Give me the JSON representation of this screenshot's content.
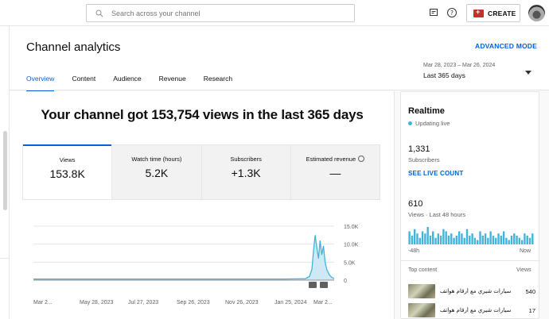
{
  "topbar": {
    "search_placeholder": "Search across your channel",
    "create_label": "CREATE"
  },
  "header": {
    "title": "Channel analytics",
    "advanced_mode": "ADVANCED MODE",
    "tabs": [
      {
        "label": "Overview",
        "active": true
      },
      {
        "label": "Content"
      },
      {
        "label": "Audience"
      },
      {
        "label": "Revenue"
      },
      {
        "label": "Research"
      }
    ],
    "date_range": {
      "dates": "Mar 28, 2023 – Mar 26, 2024",
      "label": "Last 365 days"
    }
  },
  "main": {
    "headline": "Your channel got 153,754 views in the last 365 days",
    "metrics": [
      {
        "label": "Views",
        "value": "153.8K",
        "active": true
      },
      {
        "label": "Watch time (hours)",
        "value": "5.2K"
      },
      {
        "label": "Subscribers",
        "value": "+1.3K"
      },
      {
        "label": "Estimated revenue",
        "value": "—"
      }
    ]
  },
  "chart_data": {
    "type": "area",
    "title": "",
    "xlabel": "",
    "ylabel": "",
    "ylim": [
      0,
      15000
    ],
    "y_ticks": [
      "15.0K",
      "10.0K",
      "5.0K",
      "0"
    ],
    "x_ticks": [
      "Mar 2...",
      "May 28, 2023",
      "Jul 27, 2023",
      "Sep 26, 2023",
      "Nov 26, 2023",
      "Jan 25, 2024",
      "Mar 2..."
    ],
    "series": [
      {
        "values": [
          {
            "x": "2023-03-28",
            "y": 300
          },
          {
            "x": "2023-05-28",
            "y": 300
          },
          {
            "x": "2023-07-27",
            "y": 300
          },
          {
            "x": "2023-09-26",
            "y": 300
          },
          {
            "x": "2023-11-26",
            "y": 300
          },
          {
            "x": "2024-01-25",
            "y": 300
          },
          {
            "x": "2024-02-20",
            "y": 400
          },
          {
            "x": "2024-02-25",
            "y": 1000
          },
          {
            "x": "2024-02-28",
            "y": 3000
          },
          {
            "x": "2024-03-01",
            "y": 8000
          },
          {
            "x": "2024-03-03",
            "y": 12500
          },
          {
            "x": "2024-03-05",
            "y": 9000
          },
          {
            "x": "2024-03-07",
            "y": 6000
          },
          {
            "x": "2024-03-09",
            "y": 11000
          },
          {
            "x": "2024-03-11",
            "y": 7000
          },
          {
            "x": "2024-03-13",
            "y": 9500
          },
          {
            "x": "2024-03-15",
            "y": 5000
          },
          {
            "x": "2024-03-17",
            "y": 3000
          },
          {
            "x": "2024-03-20",
            "y": 1500
          },
          {
            "x": "2024-03-23",
            "y": 800
          },
          {
            "x": "2024-03-26",
            "y": 400
          }
        ]
      }
    ],
    "colors": {
      "line": "#41b4d9",
      "fill": "#cfe9f4"
    }
  },
  "realtime": {
    "title": "Realtime",
    "status": "Updating live",
    "subscribers": "1,331",
    "subscribers_label": "Subscribers",
    "live_count_link": "SEE LIVE COUNT",
    "views": "610",
    "views_label": "Views · Last 48 hours",
    "mini_chart": [
      6,
      4,
      7,
      5,
      3,
      6,
      5,
      8,
      4,
      6,
      3,
      5,
      4,
      7,
      6,
      4,
      5,
      3,
      4,
      6,
      5,
      3,
      7,
      4,
      5,
      3,
      2,
      6,
      4,
      5,
      3,
      6,
      4,
      3,
      5,
      4,
      6,
      3,
      2,
      4,
      5,
      4,
      3,
      2,
      5,
      4,
      3,
      5
    ],
    "mini_left": "-48h",
    "mini_right": "Now",
    "top_content_label": "Top content",
    "top_content_views_label": "Views",
    "top_content": [
      {
        "title": "سيارات شيري مع أرقام هواتف",
        "views": "540"
      },
      {
        "title": "سيارات شيري مع أرقام هواتف",
        "views": "17"
      }
    ]
  }
}
